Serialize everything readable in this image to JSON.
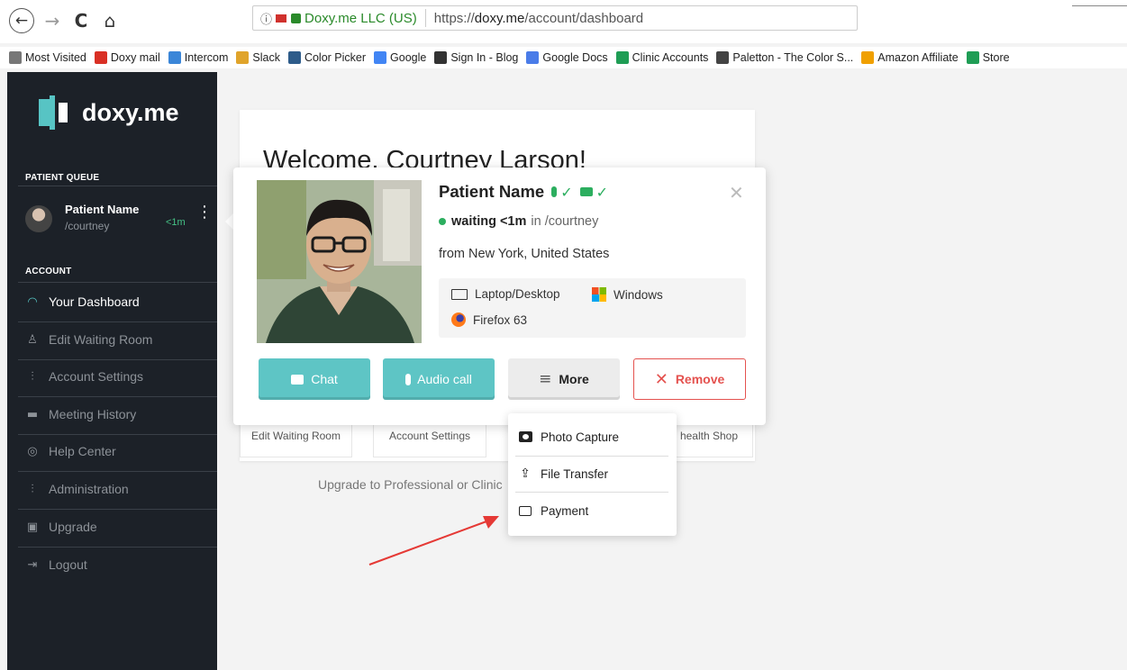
{
  "browser": {
    "nav": {
      "back": "←",
      "forward": "→",
      "reload": "C",
      "home": "⌂"
    },
    "site_identity": "Doxy.me LLC (US)",
    "url_prefix": "https://",
    "url_domain": "doxy.me",
    "url_path": "/account/dashboard",
    "bookmarks": [
      {
        "label": "Most Visited",
        "color": "#777777"
      },
      {
        "label": "Doxy mail",
        "color": "#d93025"
      },
      {
        "label": "Intercom",
        "color": "#3b86d8"
      },
      {
        "label": "Slack",
        "color": "#e0a42b"
      },
      {
        "label": "Color Picker",
        "color": "#2e5c8a"
      },
      {
        "label": "Google",
        "color": "#4285f4"
      },
      {
        "label": "Sign In - Blog",
        "color": "#333333"
      },
      {
        "label": "Google Docs",
        "color": "#4a7ce8"
      },
      {
        "label": "Clinic Accounts",
        "color": "#1f9d55"
      },
      {
        "label": "Paletton - The Color S...",
        "color": "#444444"
      },
      {
        "label": "Amazon Affiliate",
        "color": "#f0a000"
      },
      {
        "label": "Store",
        "color": "#1f9d55"
      }
    ]
  },
  "sidebar": {
    "logo_text": "doxy.me",
    "queue_label": "PATIENT QUEUE",
    "queue_item": {
      "name": "Patient Name",
      "room": "/courtney",
      "time": "<1m",
      "menu": "⋮"
    },
    "account_label": "ACCOUNT",
    "items": [
      {
        "label": "Your Dashboard",
        "icon": "dashboard-icon",
        "glyph": "◠",
        "active": true
      },
      {
        "label": "Edit Waiting Room",
        "icon": "chair-icon",
        "glyph": "♙"
      },
      {
        "label": "Account Settings",
        "icon": "sliders-icon",
        "glyph": "⫶"
      },
      {
        "label": "Meeting History",
        "icon": "camera-icon",
        "glyph": "▬"
      },
      {
        "label": "Help Center",
        "icon": "lifebuoy-icon",
        "glyph": "◎"
      },
      {
        "label": "Administration",
        "icon": "sliders-icon",
        "glyph": "⫶"
      },
      {
        "label": "Upgrade",
        "icon": "wallet-icon",
        "glyph": "▣"
      },
      {
        "label": "Logout",
        "icon": "logout-icon",
        "glyph": "⇥"
      }
    ]
  },
  "dashboard": {
    "welcome": "Welcome, Courtney Larson!",
    "tiles": [
      "Edit Waiting Room",
      "Account Settings",
      "health Shop"
    ],
    "upgrade_text": "Upgrade to Professional or Clinic"
  },
  "popover": {
    "patient_name": "Patient Name",
    "mic_ok": "✓",
    "cam_ok": "✓",
    "status_prefix": "waiting",
    "status_time": "<1m",
    "status_room": "in /courtney",
    "location": "from New York, United States",
    "device": "Laptop/Desktop",
    "os": "Windows",
    "browser": "Firefox 63",
    "close": "✕",
    "buttons": {
      "chat": "Chat",
      "audio": "Audio call",
      "more": "More",
      "remove": "Remove"
    }
  },
  "more_menu": {
    "items": [
      {
        "label": "Photo Capture",
        "icon": "camera-icon"
      },
      {
        "label": "File Transfer",
        "icon": "upload-icon"
      },
      {
        "label": "Payment",
        "icon": "wallet-icon"
      }
    ]
  },
  "colors": {
    "accent": "#5ec5c5",
    "sidebar": "#1c2128",
    "success": "#2cae5f",
    "danger": "#e4524f",
    "annotation": "#e53935"
  }
}
